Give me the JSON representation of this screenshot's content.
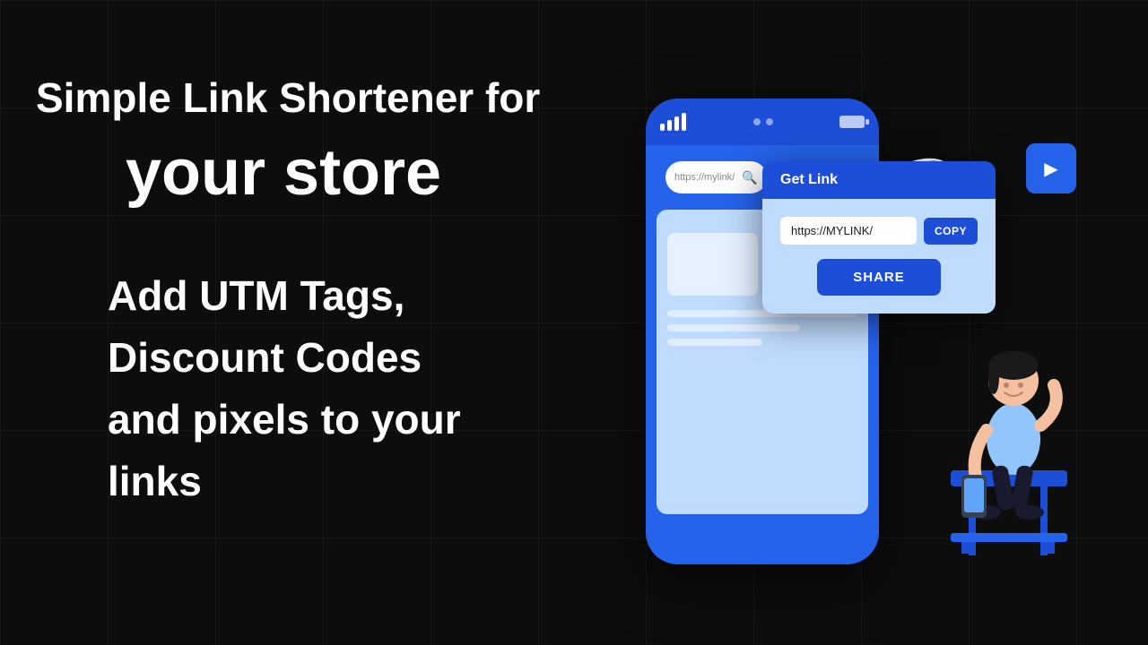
{
  "background": {
    "color": "#0d0d0d"
  },
  "headline": {
    "line1": "Simple Link Shortener for",
    "line2": "your store"
  },
  "features": {
    "line1": "Add UTM Tags,",
    "line2": "Discount Codes",
    "line3": "and pixels to your links"
  },
  "phone": {
    "search_placeholder": "https://mylink/",
    "url_display": "https://mylink/"
  },
  "popup": {
    "title": "Get Link",
    "url_value": "https://MYLINK/",
    "copy_label": "COPY",
    "share_label": "SHARE"
  },
  "icons": {
    "arrow_icon": "▶",
    "search_icon": "🔍"
  }
}
